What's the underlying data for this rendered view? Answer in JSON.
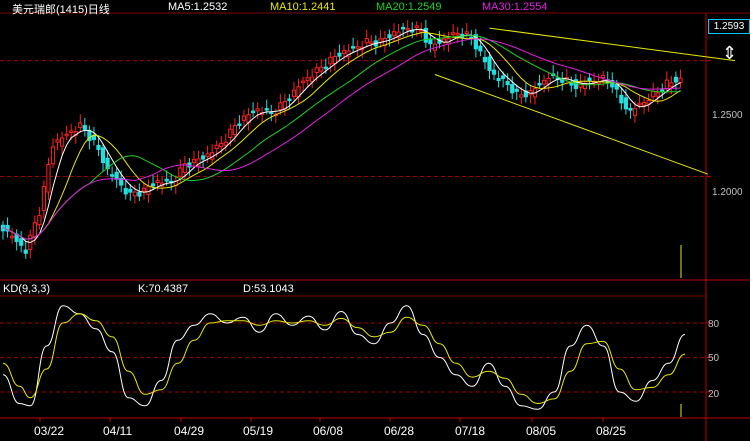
{
  "header": {
    "title": "美元瑞郎(1415)日线",
    "ma5": "MA5:1.2532",
    "ma10": "MA10:1.2441",
    "ma20": "MA20:1.2549",
    "ma30": "MA30:1.2554"
  },
  "kd_header": {
    "label": "KD(9,3,3)",
    "k": "K:70.4387",
    "d": "D:53.1043"
  },
  "current_price": "1.2593",
  "scroll_icon": "up-down-arrow-icon",
  "colors": {
    "up": "#ff2020",
    "down": "#20e0e0",
    "ma5": "#ffffff",
    "ma10": "#e8e800",
    "ma20": "#20d020",
    "ma30": "#e020e0",
    "kd_k": "#ffffff",
    "kd_d": "#e8e800",
    "channel": "#e8e800",
    "grid": "#a00000"
  },
  "chart_data": [
    {
      "type": "candlestick",
      "title": "美元瑞郎(1415)日线",
      "y_ticks": [
        "1.2500",
        "1.2000"
      ],
      "ylim": [
        1.1575,
        1.2675
      ],
      "x_ticks": [
        "03/22",
        "04/11",
        "04/29",
        "05/19",
        "06/08",
        "06/28",
        "07/18",
        "08/05",
        "08/25"
      ],
      "current_price": 1.2593,
      "moving_averages": {
        "MA5": 1.2532,
        "MA10": 1.2441,
        "MA20": 1.2549,
        "MA30": 1.2554
      },
      "close_path": [
        [
          0,
          1.178
        ],
        [
          3,
          1.172
        ],
        [
          5,
          1.168
        ],
        [
          8,
          1.185
        ],
        [
          11,
          1.214
        ],
        [
          14,
          1.218
        ],
        [
          17,
          1.222
        ],
        [
          20,
          1.215
        ],
        [
          23,
          1.203
        ],
        [
          26,
          1.196
        ],
        [
          28,
          1.192
        ],
        [
          31,
          1.194
        ],
        [
          34,
          1.198
        ],
        [
          37,
          1.197
        ],
        [
          40,
          1.205
        ],
        [
          44,
          1.208
        ],
        [
          48,
          1.214
        ],
        [
          52,
          1.224
        ],
        [
          56,
          1.229
        ],
        [
          59,
          1.227
        ],
        [
          62,
          1.232
        ],
        [
          66,
          1.241
        ],
        [
          70,
          1.247
        ],
        [
          74,
          1.253
        ],
        [
          77,
          1.255
        ],
        [
          80,
          1.258
        ],
        [
          83,
          1.258
        ],
        [
          86,
          1.262
        ],
        [
          89,
          1.264
        ],
        [
          92,
          1.263
        ],
        [
          94,
          1.256
        ],
        [
          97,
          1.259
        ],
        [
          100,
          1.262
        ],
        [
          103,
          1.26
        ],
        [
          105,
          1.253
        ],
        [
          107,
          1.246
        ],
        [
          109,
          1.242
        ],
        [
          111,
          1.24
        ],
        [
          113,
          1.235
        ],
        [
          116,
          1.236
        ],
        [
          118,
          1.24
        ],
        [
          120,
          1.243
        ],
        [
          123,
          1.242
        ],
        [
          126,
          1.239
        ],
        [
          129,
          1.241
        ],
        [
          132,
          1.242
        ],
        [
          134,
          1.24
        ],
        [
          136,
          1.232
        ],
        [
          138,
          1.228
        ],
        [
          140,
          1.231
        ],
        [
          143,
          1.235
        ],
        [
          146,
          1.24
        ],
        [
          149,
          1.242
        ]
      ]
    },
    {
      "type": "line",
      "title": "KD(9,3,3)",
      "y_ticks": [
        80,
        50,
        20
      ],
      "ylim": [
        0,
        100
      ],
      "series": [
        {
          "name": "K",
          "last": 70.4387,
          "path": [
            [
              0,
              35
            ],
            [
              3,
              10
            ],
            [
              5,
              8
            ],
            [
              8,
              60
            ],
            [
              11,
              95
            ],
            [
              14,
              88
            ],
            [
              17,
              75
            ],
            [
              20,
              55
            ],
            [
              23,
              15
            ],
            [
              26,
              8
            ],
            [
              29,
              30
            ],
            [
              32,
              65
            ],
            [
              35,
              78
            ],
            [
              38,
              88
            ],
            [
              41,
              80
            ],
            [
              44,
              85
            ],
            [
              47,
              72
            ],
            [
              50,
              88
            ],
            [
              53,
              78
            ],
            [
              56,
              86
            ],
            [
              59,
              74
            ],
            [
              62,
              90
            ],
            [
              65,
              70
            ],
            [
              68,
              62
            ],
            [
              71,
              80
            ],
            [
              74,
              95
            ],
            [
              77,
              70
            ],
            [
              80,
              50
            ],
            [
              83,
              35
            ],
            [
              86,
              25
            ],
            [
              89,
              45
            ],
            [
              92,
              25
            ],
            [
              95,
              8
            ],
            [
              98,
              5
            ],
            [
              101,
              20
            ],
            [
              104,
              60
            ],
            [
              107,
              78
            ],
            [
              110,
              60
            ],
            [
              113,
              20
            ],
            [
              116,
              12
            ],
            [
              119,
              30
            ],
            [
              122,
              45
            ],
            [
              125,
              70
            ]
          ]
        },
        {
          "name": "D",
          "last": 53.1043,
          "path": [
            [
              0,
              45
            ],
            [
              3,
              25
            ],
            [
              5,
              15
            ],
            [
              8,
              40
            ],
            [
              11,
              80
            ],
            [
              14,
              88
            ],
            [
              17,
              82
            ],
            [
              20,
              68
            ],
            [
              23,
              38
            ],
            [
              26,
              18
            ],
            [
              29,
              22
            ],
            [
              32,
              45
            ],
            [
              35,
              65
            ],
            [
              38,
              80
            ],
            [
              41,
              82
            ],
            [
              44,
              82
            ],
            [
              47,
              78
            ],
            [
              50,
              82
            ],
            [
              53,
              80
            ],
            [
              56,
              82
            ],
            [
              59,
              78
            ],
            [
              62,
              84
            ],
            [
              65,
              76
            ],
            [
              68,
              68
            ],
            [
              71,
              72
            ],
            [
              74,
              85
            ],
            [
              77,
              78
            ],
            [
              80,
              62
            ],
            [
              83,
              45
            ],
            [
              86,
              33
            ],
            [
              89,
              38
            ],
            [
              92,
              32
            ],
            [
              95,
              18
            ],
            [
              98,
              10
            ],
            [
              101,
              14
            ],
            [
              104,
              38
            ],
            [
              107,
              62
            ],
            [
              110,
              64
            ],
            [
              113,
              40
            ],
            [
              116,
              22
            ],
            [
              119,
              24
            ],
            [
              122,
              35
            ],
            [
              125,
              53
            ]
          ]
        }
      ]
    }
  ]
}
